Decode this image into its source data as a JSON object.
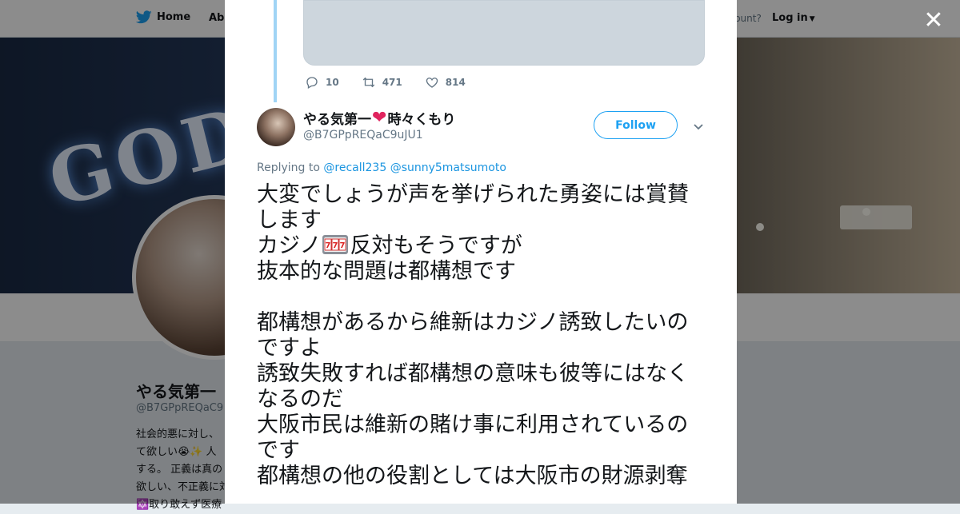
{
  "topbar": {
    "home_label": "Home",
    "about_label": "Abo",
    "account_prompt": "ccount?",
    "login_label": "Log in"
  },
  "banner": {
    "text": "GOD"
  },
  "background_profile": {
    "name": "やる気第一",
    "handle": "@B7GPpREQaC9",
    "bio_lines": [
      "社会的悪に対し、",
      "て欲しい😭✨ 人",
      "する。 正義は真の",
      "欲しい、不正義に対",
      "🔯取り敢えず医療"
    ]
  },
  "modal": {
    "previous_tweet": {
      "reply_count": "10",
      "retweet_count": "471",
      "like_count": "814"
    },
    "tweet": {
      "name_part1": "やる気第一",
      "heart": "❤",
      "name_part2": "時々くもり",
      "handle": "@B7GPpREQaC9uJU1",
      "follow_label": "Follow",
      "replying_prefix": "Replying to",
      "reply_mention_1": "@recall235",
      "reply_mention_2": "@sunny5matsumoto",
      "text_line_1": "大変でしょうが声を挙げられた勇姿には賞賛します",
      "text_casino": "カジノ",
      "text_after_emoji": "反対もそうですが",
      "text_rest": "抜本的な問題は都構想です\n\n都構想があるから維新はカジノ誘致したいのですよ\n誘致失敗すれば都構想の意味も彼等にはなくなるのだ\n大阪市民は維新の賭け事に利用されているのです\n都構想の他の役割としては大阪市の財源剥奪"
    }
  },
  "colors": {
    "twitter_blue": "#1da1f2",
    "link_blue": "#1b95e0",
    "heart_red": "#e0245e",
    "thread_line": "#a0d4f5",
    "text_primary": "#14171a",
    "text_secondary": "#657786"
  },
  "icons": [
    "twitter-bird-icon",
    "caret-down-icon",
    "close-icon",
    "reply-icon",
    "retweet-icon",
    "like-icon",
    "slot-machine-emoji",
    "chevron-down-icon"
  ]
}
